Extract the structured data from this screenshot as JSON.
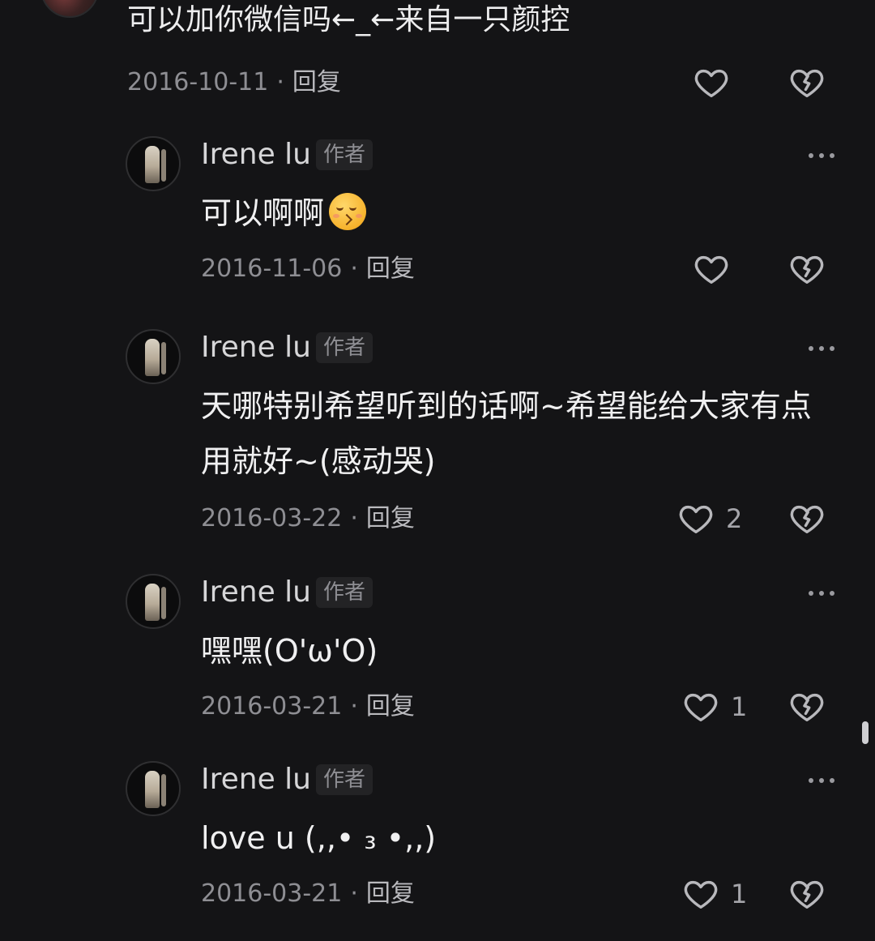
{
  "top_comment": {
    "text": "可以加你微信吗←_←来自一只颜控",
    "date": "2016-10-11",
    "reply_label": "回复"
  },
  "replies": [
    {
      "username": "Irene lu",
      "tag": "作者",
      "text": "可以啊啊",
      "emoji": "kissing-face-emoji",
      "date": "2016-11-06",
      "reply_label": "回复",
      "like_count": ""
    },
    {
      "username": "Irene lu",
      "tag": "作者",
      "text_line1": "天哪特别希望听到的话啊~希望能给大家有点",
      "text_line2": "用就好~(感动哭)",
      "date": "2016-03-22",
      "reply_label": "回复",
      "like_count": "2"
    },
    {
      "username": "Irene lu",
      "tag": "作者",
      "text": "嘿嘿(O'ω'O)",
      "date": "2016-03-21",
      "reply_label": "回复",
      "like_count": "1"
    },
    {
      "username": "Irene lu",
      "tag": "作者",
      "text": "love u  (,,• ₃ •,,)",
      "date": "2016-03-21",
      "reply_label": "回复",
      "like_count": "1"
    }
  ],
  "icons": {
    "like": "heart-outline-icon",
    "dislike": "broken-heart-icon",
    "more": "more-dots-icon"
  },
  "colors": {
    "background": "#141416",
    "primary_text": "#f0f0f1",
    "secondary_text": "#8e8e93",
    "tag_background": "#232325"
  }
}
